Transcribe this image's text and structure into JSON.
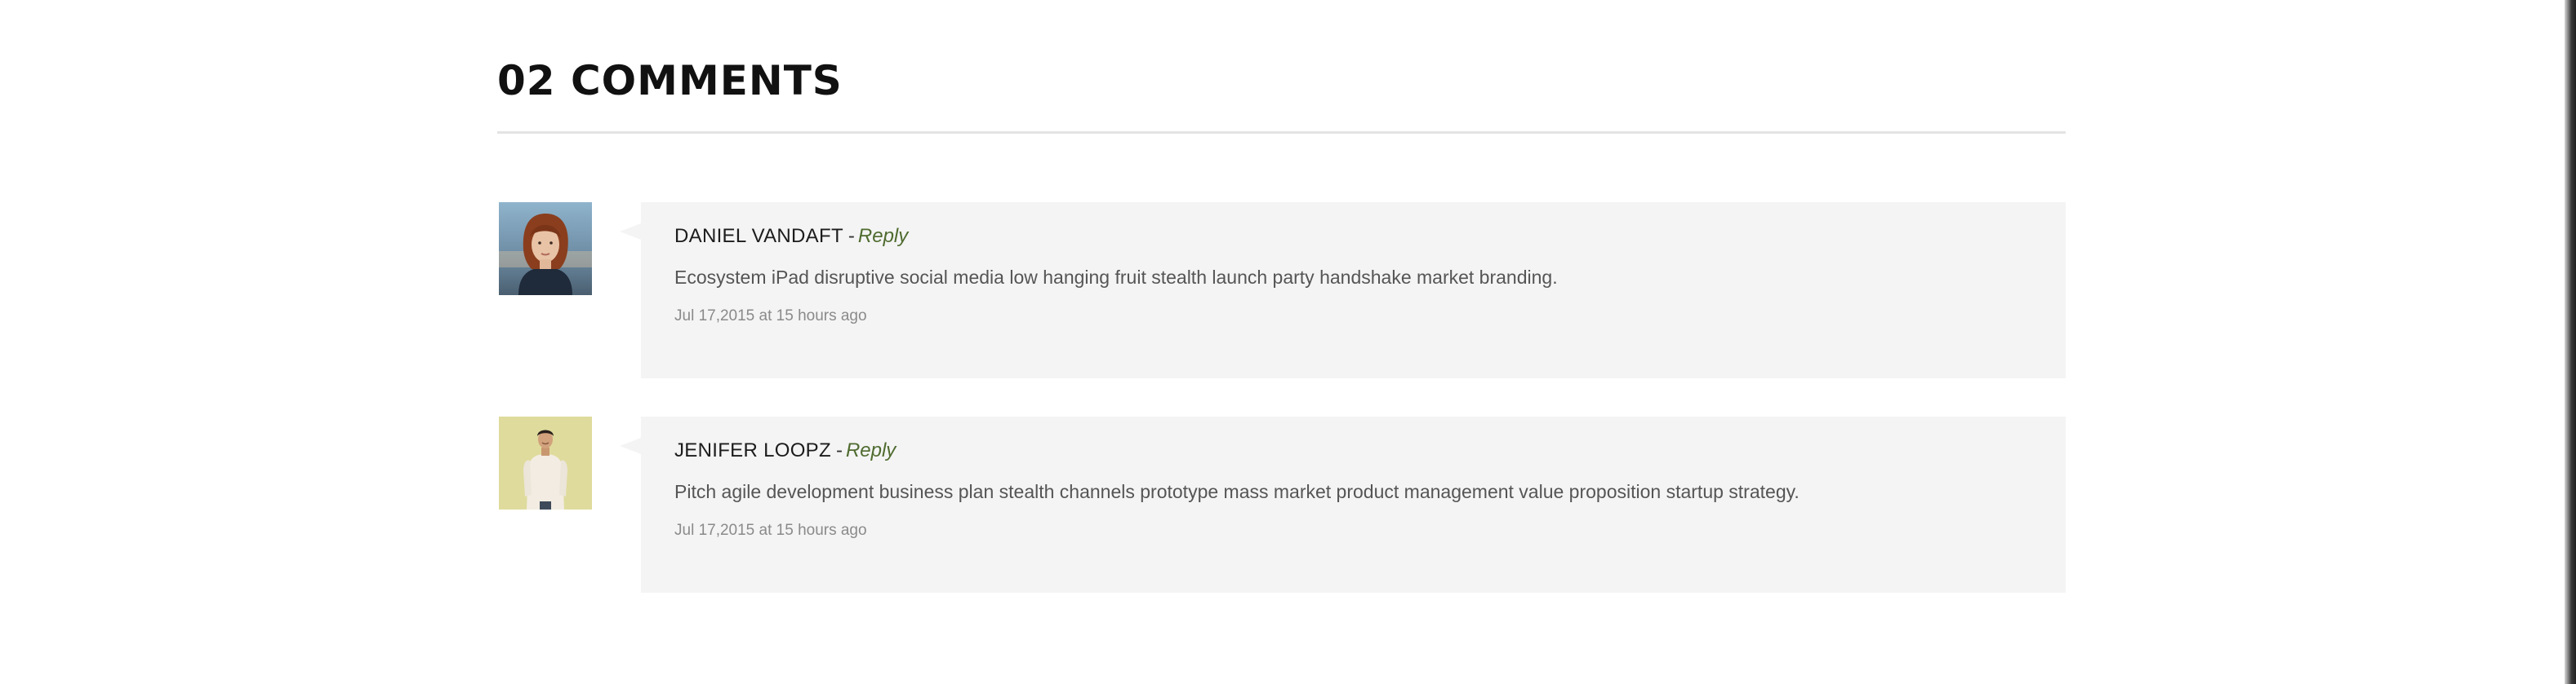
{
  "comments_section": {
    "title": "02 COMMENTS",
    "comments": [
      {
        "author": "DANIEL VANDAFT",
        "separator": "-",
        "reply_label": "Reply",
        "text": "Ecosystem iPad disruptive social media low hanging fruit stealth launch party handshake market branding.",
        "date": "Jul 17,2015 at 15 hours ago",
        "avatar": "avatar-woman-red-hair"
      },
      {
        "author": "JENIFER LOOPZ",
        "separator": "-",
        "reply_label": "Reply",
        "text": "Pitch agile development business plan stealth channels prototype mass market product management value proposition startup strategy.",
        "date": "Jul 17,2015 at 15 hours ago",
        "avatar": "avatar-man-white-sweater"
      }
    ]
  },
  "colors": {
    "bubble_background": "#f4f4f4",
    "reply_link": "#4f6b2f",
    "title": "#111111",
    "body_text": "#555555",
    "date_text": "#8a8a8a"
  }
}
